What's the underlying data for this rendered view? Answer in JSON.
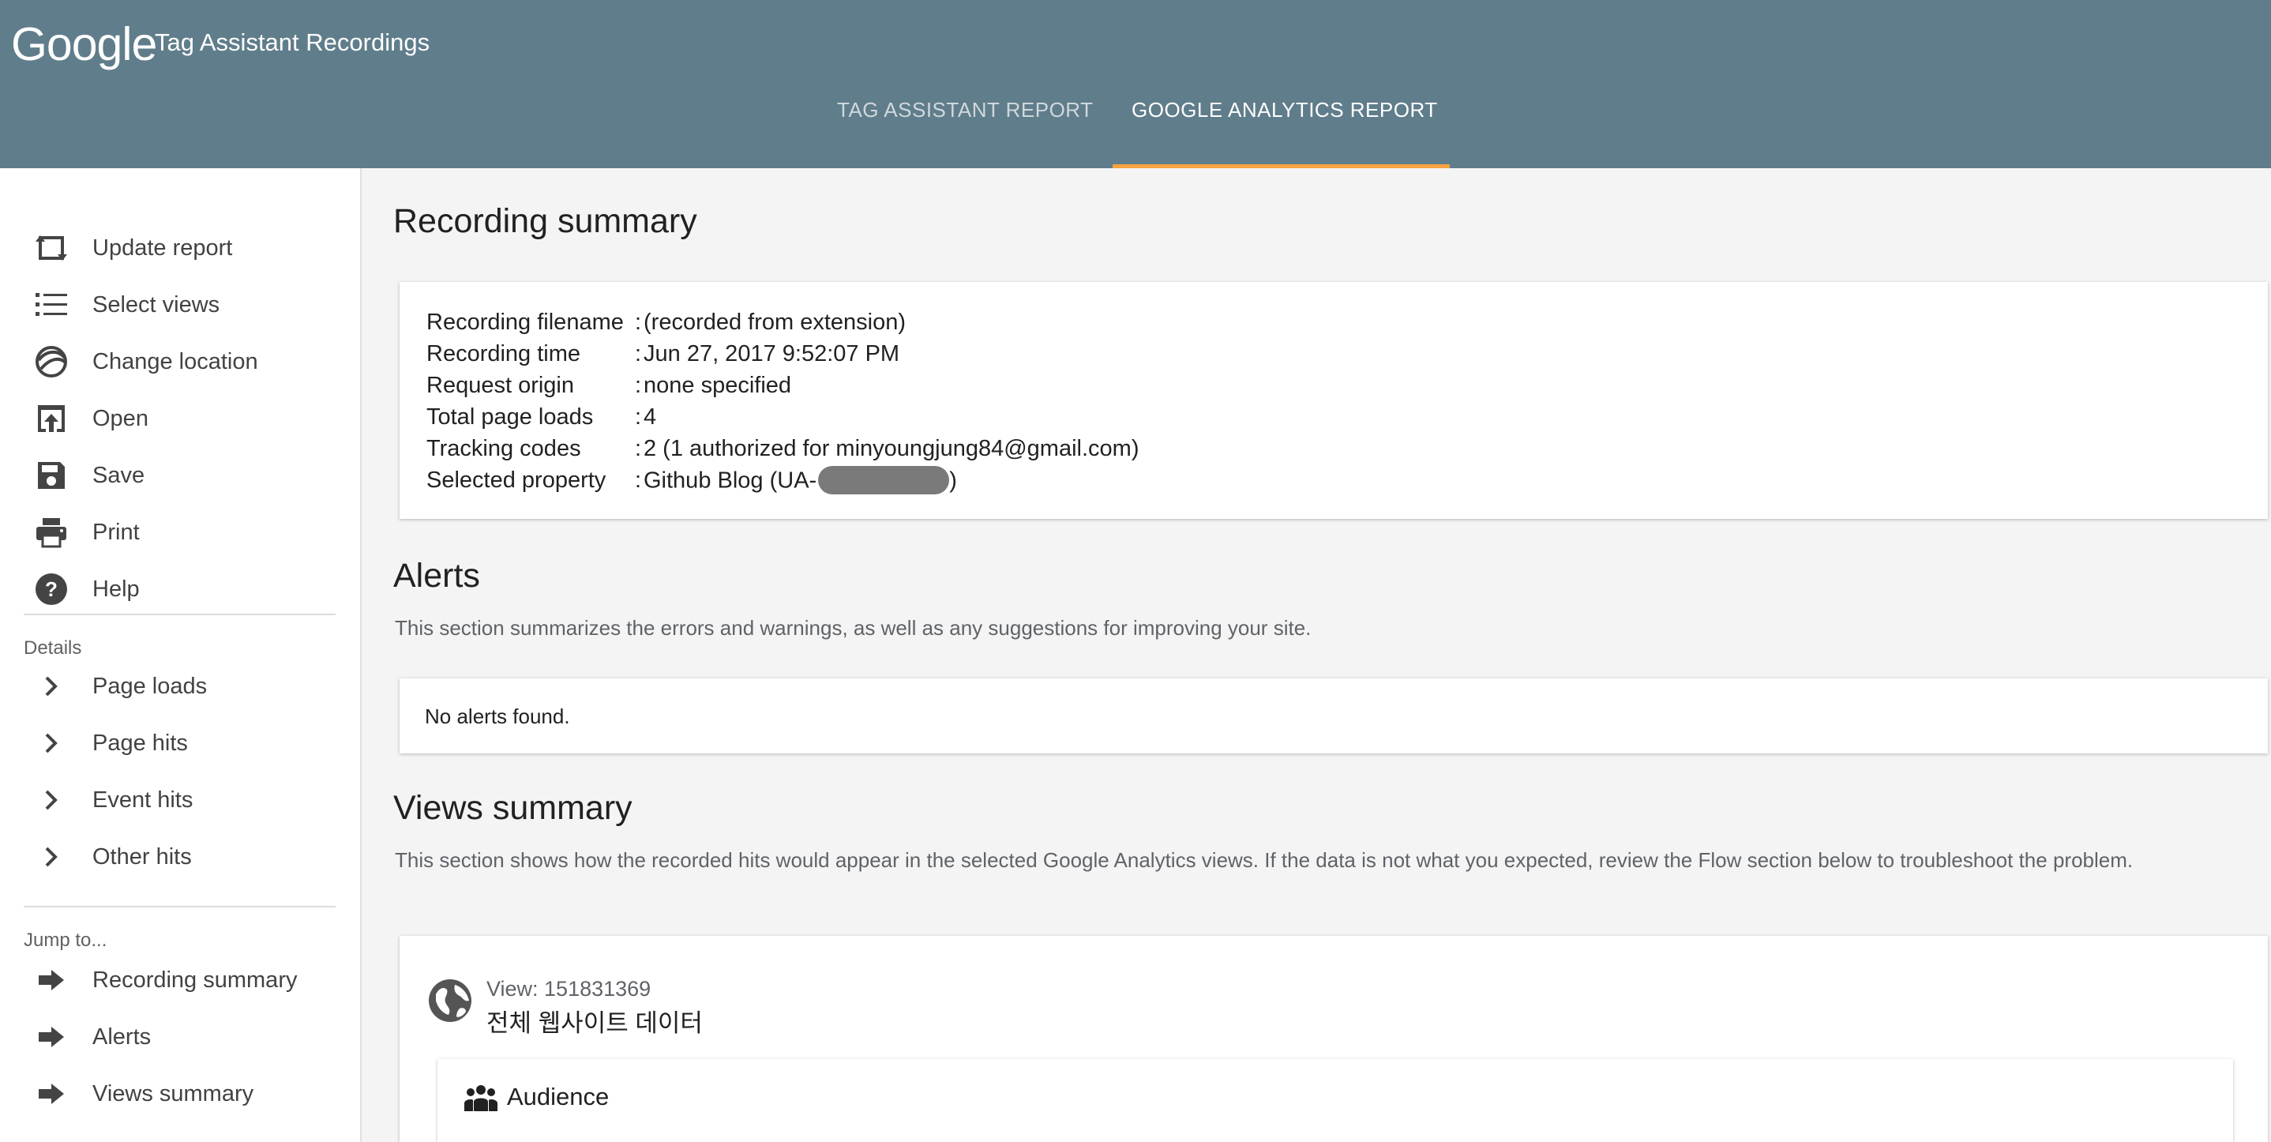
{
  "header": {
    "logo": "Google",
    "app_title": "Tag Assistant Recordings",
    "tabs": [
      {
        "label": "TAG ASSISTANT REPORT",
        "active": false
      },
      {
        "label": "GOOGLE ANALYTICS REPORT",
        "active": true
      }
    ],
    "accent_color": "#f9a23f",
    "bar_color": "#607d8b"
  },
  "sidebar": {
    "actions": [
      {
        "label": "Update report",
        "icon": "update-icon"
      },
      {
        "label": "Select views",
        "icon": "list-icon"
      },
      {
        "label": "Change location",
        "icon": "globe-icon"
      },
      {
        "label": "Open",
        "icon": "open-icon"
      },
      {
        "label": "Save",
        "icon": "save-icon"
      },
      {
        "label": "Print",
        "icon": "print-icon"
      },
      {
        "label": "Help",
        "icon": "help-icon"
      }
    ],
    "details_label": "Details",
    "details": [
      {
        "label": "Page loads",
        "icon": "chevron-right-icon"
      },
      {
        "label": "Page hits",
        "icon": "chevron-right-icon"
      },
      {
        "label": "Event hits",
        "icon": "chevron-right-icon"
      },
      {
        "label": "Other hits",
        "icon": "chevron-right-icon"
      }
    ],
    "jump_label": "Jump to...",
    "jump": [
      {
        "label": "Recording summary",
        "icon": "arrow-right-icon"
      },
      {
        "label": "Alerts",
        "icon": "arrow-right-icon"
      },
      {
        "label": "Views summary",
        "icon": "arrow-right-icon"
      }
    ]
  },
  "main": {
    "recording_summary": {
      "title": "Recording summary",
      "rows": [
        {
          "key": "Recording filename",
          "value": "(recorded from extension)"
        },
        {
          "key": "Recording time",
          "value": "Jun 27, 2017 9:52:07 PM"
        },
        {
          "key": "Request origin",
          "value": "none specified"
        },
        {
          "key": "Total page loads",
          "value": "4"
        },
        {
          "key": "Tracking codes",
          "value": "2 (1 authorized for minyoungjung84@gmail.com)"
        },
        {
          "key": "Selected property",
          "value_prefix": "Github Blog (UA-",
          "value_suffix": ")"
        }
      ],
      "separator": ":"
    },
    "alerts": {
      "title": "Alerts",
      "description": "This section summarizes the errors and warnings, as well as any suggestions for improving your site.",
      "message": "No alerts found."
    },
    "views_summary": {
      "title": "Views summary",
      "description": "This section shows how the recorded hits would appear in the selected Google Analytics views. If the data is not what you expected, review the Flow section below to troubleshoot the problem.",
      "view_id_label": "View: 151831369",
      "view_name": "전체 웹사이트 데이터",
      "audience_title": "Audience"
    }
  }
}
